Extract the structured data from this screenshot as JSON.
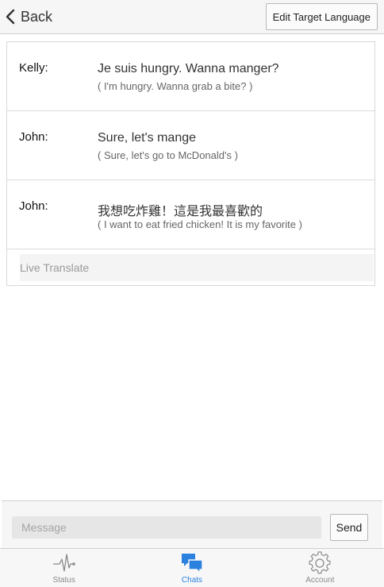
{
  "header": {
    "back_label": "Back",
    "edit_language_label": "Edit Target Language"
  },
  "messages": [
    {
      "sender": "Kelly:",
      "original": "Je suis hungry. Wanna manger?",
      "translation": "( I'm hungry. Wanna grab a bite? )"
    },
    {
      "sender": "John:",
      "original": "Sure, let's mange",
      "translation": "( Sure, let's go to McDonald's )"
    },
    {
      "sender": "John:",
      "original": "我想吃炸雞！這是我最喜歡的",
      "translation": "( I want to eat fried chicken! It is my favorite )"
    }
  ],
  "live_translate_label": "Live Translate",
  "composer": {
    "placeholder": "Message",
    "send_label": "Send"
  },
  "tabs": [
    {
      "label": "Status",
      "icon": "pulse-icon",
      "active": false
    },
    {
      "label": "Chats",
      "icon": "chat-bubbles-icon",
      "active": true
    },
    {
      "label": "Account",
      "icon": "gear-icon",
      "active": false
    }
  ],
  "colors": {
    "accent": "#2a82de",
    "inactive": "#8a8a8a"
  }
}
